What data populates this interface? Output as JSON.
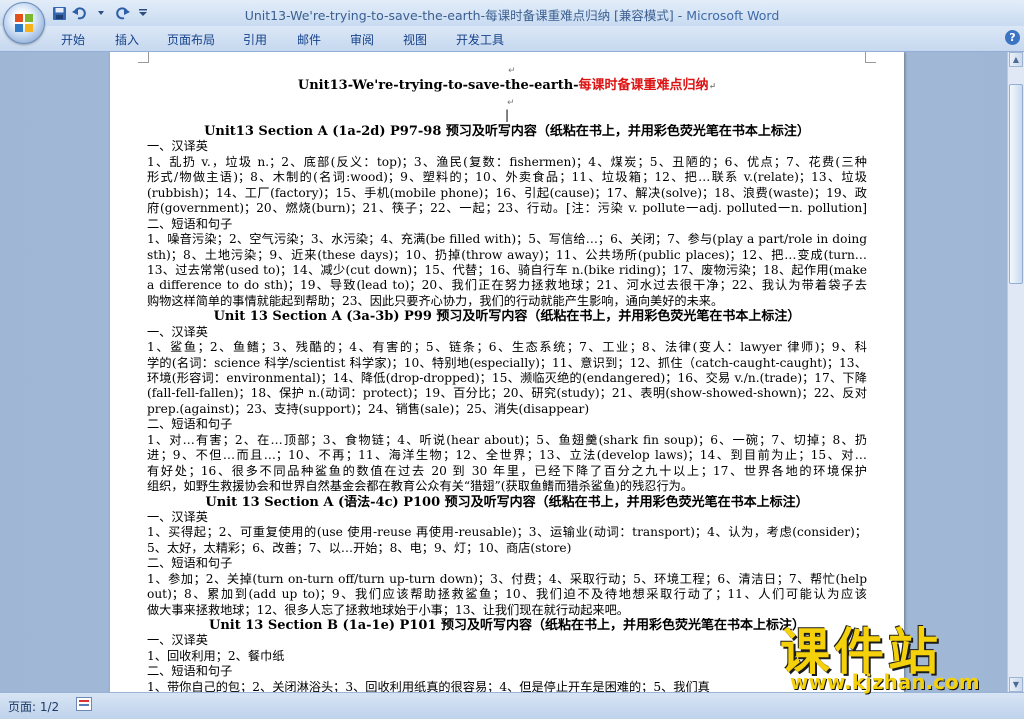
{
  "window": {
    "title": "Unit13-We're-trying-to-save-the-earth-每课时备课重难点归纳 [兼容模式]",
    "app_name": "Microsoft Word",
    "separator": " - "
  },
  "ribbon": {
    "tabs": [
      "开始",
      "插入",
      "页面布局",
      "引用",
      "邮件",
      "审阅",
      "视图",
      "开发工具"
    ],
    "help_label": "?"
  },
  "document": {
    "title_plain": "Unit13-We're-trying-to-save-the-earth-",
    "title_red": "每课时备课重难点归纳",
    "lines": [
      {
        "t": "Unit13 Section A (1a-2d) P97-98 预习及听写内容（纸粘在书上，并用彩色荧光笔在书本上标注）",
        "s": "hc"
      },
      {
        "t": "一、汉译英",
        "s": ""
      },
      {
        "t": "1、乱扔 v.，垃圾 n.；2、底部(反义：top)；3、渔民(复数：fishermen)；4、煤炭；5、丑陋的；6、优点；7、花费(三种",
        "s": "j"
      },
      {
        "t": "形式/物做主语)；8、木制的(名词:wood)；9、塑料的；10、外卖食品；11、垃圾箱；12、把…联系 v.(relate)；13、垃圾",
        "s": "j"
      },
      {
        "t": "(rubbish)；14、工厂(factory)；15、手机(mobile phone)；16、引起(cause)；17、解决(solve)；18、浪费(waste)；19、政",
        "s": "j"
      },
      {
        "t": "府(government)；20、燃烧(burn)；21、筷子；22、一起；23、行动。[注：污染 v. pollute一adj. polluted一n. pollution]",
        "s": "j"
      },
      {
        "t": "二、短语和句子",
        "s": ""
      },
      {
        "t": "1、噪音污染；2、空气污染；3、水污染；4、充满(be filled with)；5、写信给…；6、关闭；7、参与(play a part/role in doing",
        "s": "j"
      },
      {
        "t": "sth)；8、土地污染；9、近来(these days)；10、扔掉(throw away)；11、公共场所(public places)；12、把…变成(turn…into)；",
        "s": "j"
      },
      {
        "t": "13、过去常常(used to)；14、减少(cut down)；15、代替；16、骑自行车 n.(bike riding)；17、废物污染；18、起作用(make",
        "s": "j"
      },
      {
        "t": "a difference to do sth)；19、导致(lead to)；20、我们正在努力拯救地球；21、河水过去很干净；22、我认为带着袋子去",
        "s": "j"
      },
      {
        "t": "购物这样简单的事情就能起到帮助；23、因此只要齐心协力，我们的行动就能产生影响，通向美好的未来。",
        "s": ""
      },
      {
        "t": "Unit 13 Section A (3a-3b) P99 预习及听写内容（纸粘在书上，并用彩色荧光笔在书本上标注）",
        "s": "hc"
      },
      {
        "t": "一、汉译英",
        "s": ""
      },
      {
        "t": "1、鲨鱼；2、鱼鳍；3、残酷的；4、有害的；5、链条；6、生态系统；7、工业；8、法律(变人：lawyer 律师)；9、科",
        "s": "j"
      },
      {
        "t": "学的(名词：science 科学/scientist 科学家)；10、特别地(especially)；11、意识到；12、抓住（catch-caught-caught)；13、",
        "s": "j"
      },
      {
        "t": "环境(形容词：environmental)；14、降低(drop-dropped)；15、濒临灭绝的(endangered)；16、交易 v./n.(trade)；17、下降",
        "s": "j"
      },
      {
        "t": "(fall-fell-fallen)；18、保护 n.(动词：protect)；19、百分比；20、研究(study)；21、表明(show-showed-shown)；22、反对",
        "s": "j"
      },
      {
        "t": "prep.(against)；23、支持(support)；24、销售(sale)；25、消失(disappear)",
        "s": ""
      },
      {
        "t": "二、短语和句子",
        "s": ""
      },
      {
        "t": "1、对…有害；2、在…顶部；3、食物链；4、听说(hear about)；5、鱼翅羹(shark fin soup)；6、一碗；7、切掉；8、扔",
        "s": "j"
      },
      {
        "t": "进；9、不但…而且…；10、不再；11、海洋生物；12、全世界；13、立法(develop laws)；14、到目前为止；15、对…",
        "s": "j"
      },
      {
        "t": "有好处；16、很多不同品种鲨鱼的数值在过去 20 到 30 年里，已经下降了百分之九十以上；17、世界各地的环境保护",
        "s": "j"
      },
      {
        "t": "组织，如野生救援协会和世界自然基金会都在教育公众有关“猎翅”(获取鱼鳍而猎杀鲨鱼)的残忍行为。",
        "s": ""
      },
      {
        "t": "Unit 13 Section A (语法-4c) P100 预习及听写内容（纸粘在书上，并用彩色荧光笔在书本上标注）",
        "s": "hc"
      },
      {
        "t": "一、汉译英",
        "s": ""
      },
      {
        "t": "1、买得起；2、可重复使用的(use 使用-reuse 再使用-reusable)；3、运输业(动词：transport)；4、认为，考虑(consider)；",
        "s": "j"
      },
      {
        "t": "5、太好，太精彩；6、改善；7、以…开始；8、电；9、灯；10、商店(store)",
        "s": ""
      },
      {
        "t": "二、短语和句子",
        "s": ""
      },
      {
        "t": "1、参加；2、关掉(turn on-turn off/turn up-turn down)；3、付费；4、采取行动；5、环境工程；6、清洁日；7、帮忙(help",
        "s": "j"
      },
      {
        "t": "out)；8、累加到(add up to)；9、我们应该帮助拯救鲨鱼；10、我们迫不及待地想采取行动了；11、人们可能认为应该",
        "s": "j"
      },
      {
        "t": "做大事来拯救地球；12、很多人忘了拯救地球始于小事；13、让我们现在就行动起来吧。",
        "s": ""
      },
      {
        "t": "Unit 13 Section B (1a-1e) P101 预习及听写内容（纸粘在书上，并用彩色荧光笔在书本上标注）",
        "s": "hc"
      },
      {
        "t": "一、汉译英",
        "s": ""
      },
      {
        "t": "1、回收利用；2、餐巾纸",
        "s": ""
      },
      {
        "t": "二、短语和句子",
        "s": ""
      },
      {
        "t": "1、带你自己的包；2、关闭淋浴头；3、回收利用纸真的很容易；4、但是停止开车是困难的；5、我们真",
        "s": ""
      }
    ]
  },
  "statusbar": {
    "page_label": "页面: 1/2"
  },
  "watermark": {
    "brand": "课件站",
    "url": "www.kjzhan.com"
  },
  "colors": {
    "title_red": "#d11111",
    "app_name_blue": "#3e6aa8",
    "watermark_yellow": "#f4d10b"
  }
}
